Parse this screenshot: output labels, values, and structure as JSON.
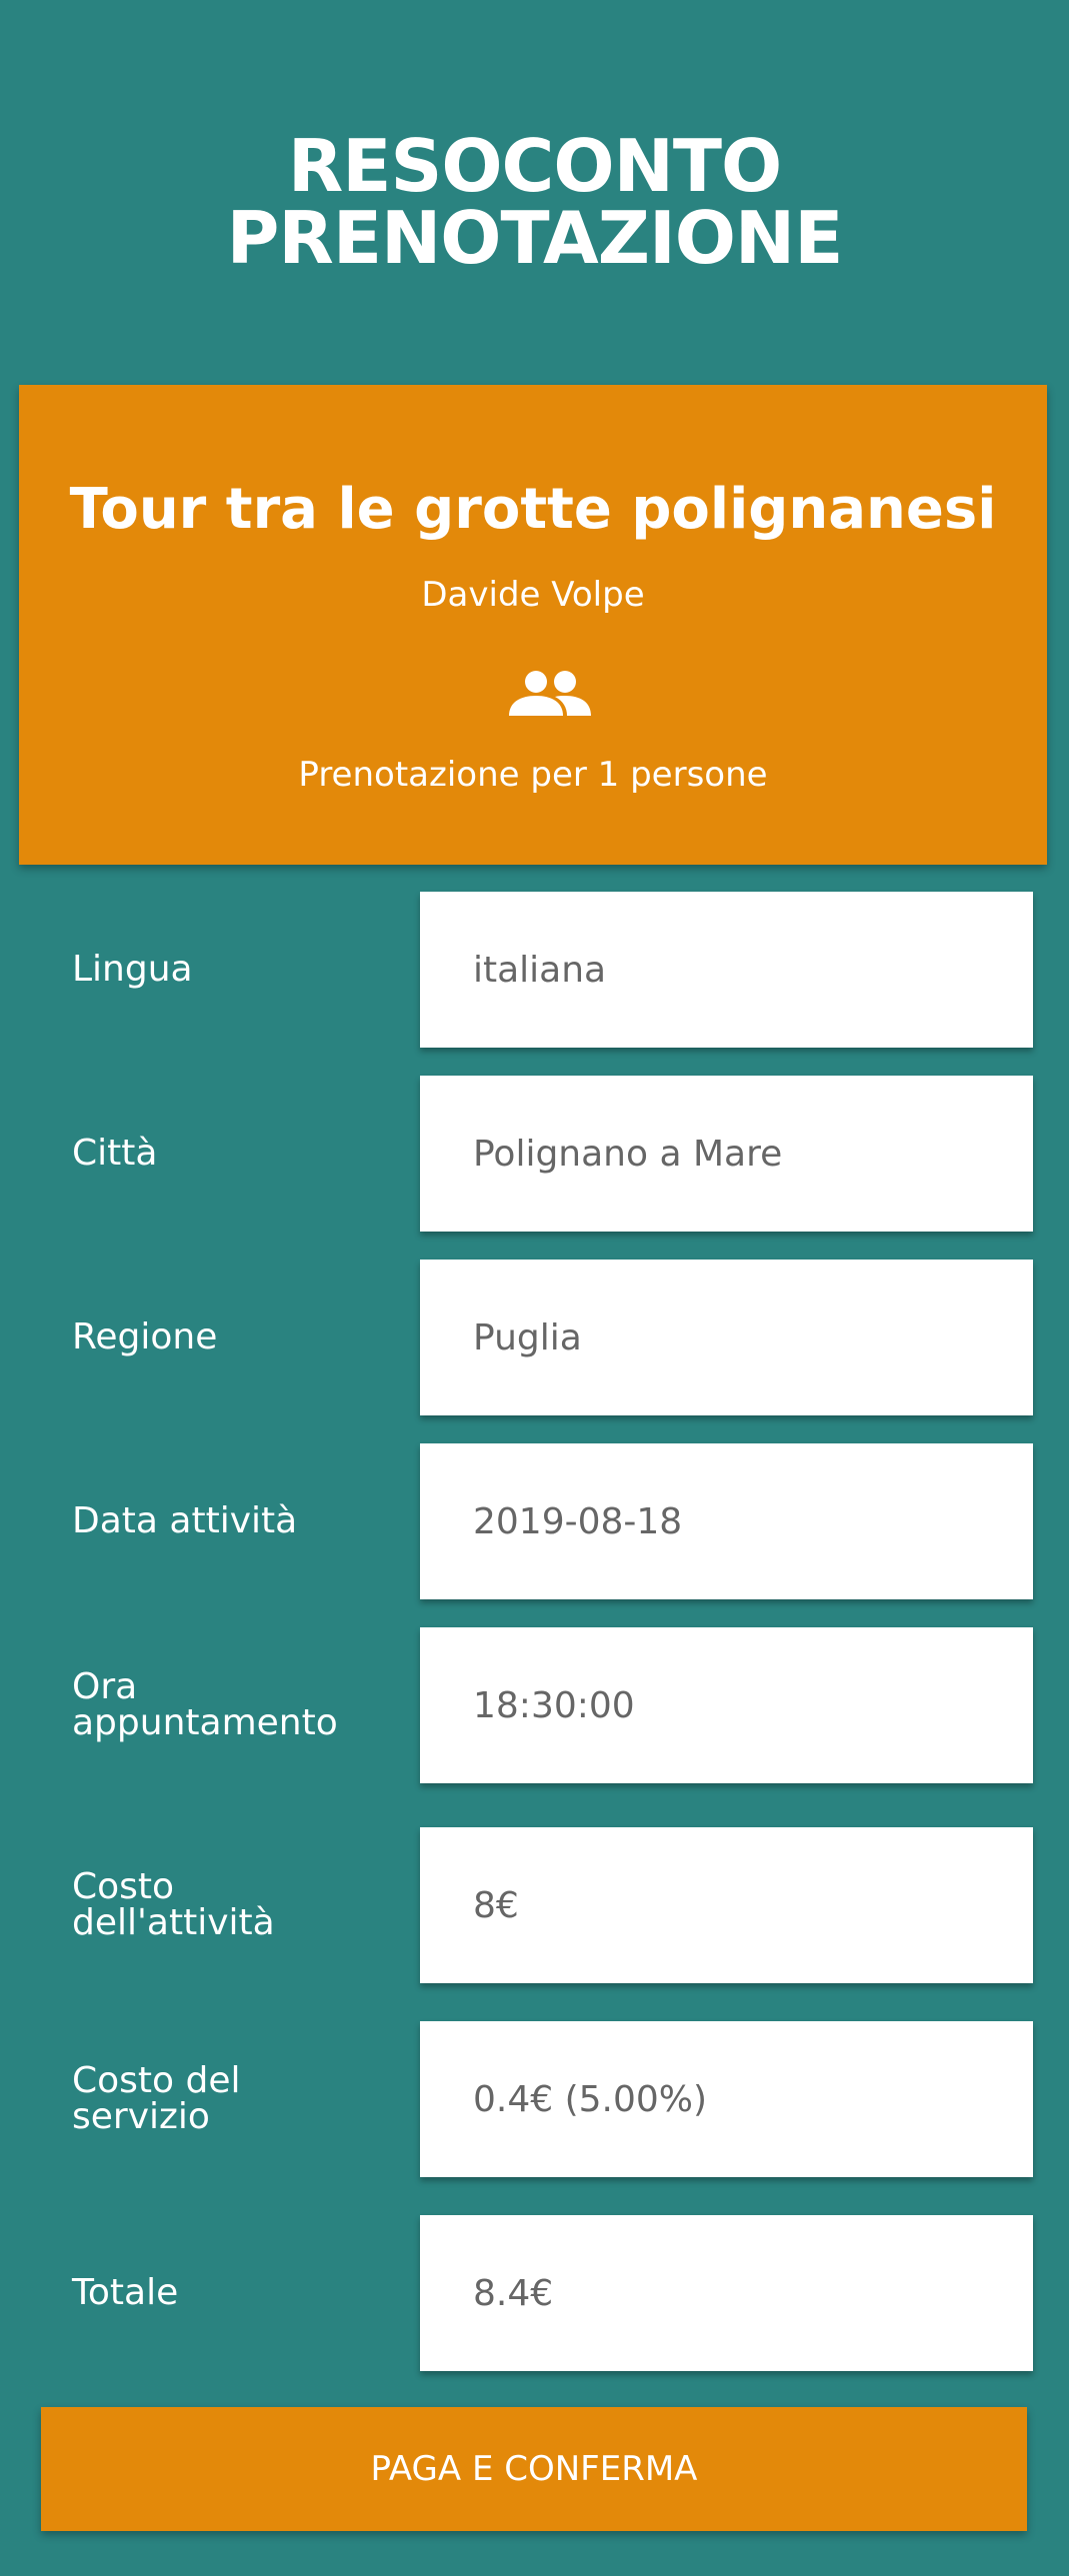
{
  "header": {
    "title_line1": "RESOCONTO",
    "title_line2": "PRENOTAZIONE"
  },
  "summary": {
    "tour_title": "Tour tra le grotte polignanesi",
    "guide_name": "Davide Volpe",
    "people_icon": "group-icon",
    "booking_count": "Prenotazione per 1 persone",
    "color": "#e3890a"
  },
  "details": {
    "lingua": {
      "label": "Lingua",
      "value": "italiana"
    },
    "citta": {
      "label": "Città",
      "value": "Polignano a Mare"
    },
    "regione": {
      "label": "Regione",
      "value": "Puglia"
    },
    "data": {
      "label": "Data attività",
      "value": "2019-08-18"
    },
    "ora": {
      "label_line1": "Ora",
      "label_line2": "appuntamento",
      "value": "18:30:00"
    },
    "costo_attivita": {
      "label_line1": "Costo",
      "label_line2": "dell'attività",
      "value": "8€"
    },
    "costo_servizio": {
      "label_line1": "Costo del",
      "label_line2": "servizio",
      "value": "0.4€ (5.00%)"
    },
    "totale": {
      "label": "Totale",
      "value": "8.4€"
    }
  },
  "actions": {
    "pay_label": "PAGA E CONFERMA"
  },
  "colors": {
    "background": "#2a8380",
    "accent": "#e3890a",
    "value_text": "#666666"
  }
}
